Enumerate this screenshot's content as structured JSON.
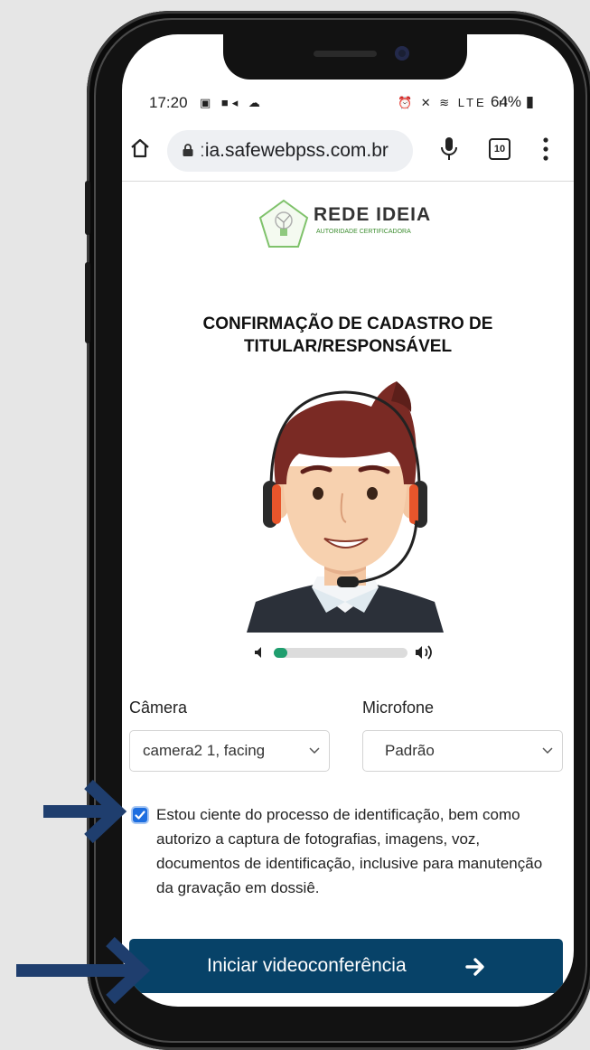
{
  "status_bar": {
    "time": "17:20",
    "left_icons": "▣ ■◂ ☁",
    "right_icons": "⏰ ✕ ≋ LTE .ıl",
    "battery": "64%"
  },
  "browser": {
    "url": "ːia.safewebpss.com.br",
    "tab_count": "10"
  },
  "logo": {
    "title": "REDE IDEIA",
    "subtitle": "AUTORIDADE CERTIFICADORA"
  },
  "page": {
    "title_line1": "CONFIRMAÇÃO DE CADASTRO DE",
    "title_line2": "TITULAR/RESPONSÁVEL"
  },
  "audio_meter": {
    "level": 0.1
  },
  "camera": {
    "label": "Câmera",
    "selected": "camera2 1, facing"
  },
  "microphone": {
    "label": "Microfone",
    "selected": "Padrão"
  },
  "consent": {
    "checked": true,
    "text": "Estou ciente do processo de identificação, bem como autorizo a captura de fotografias, imagens, voz, documentos de identificação, inclusive para manutenção da gravação em dossiê."
  },
  "start_button": {
    "label": "Iniciar videoconferência"
  },
  "colors": {
    "button": "#074268",
    "meter_fill": "#1f9e6e",
    "checkbox": "#1d6ee0",
    "pointer_arrow": "#1f3e6e",
    "headset_accent": "#e8552b"
  },
  "icons": [
    "home-icon",
    "lock-icon",
    "mic-icon",
    "tabs-icon",
    "menu-icon",
    "volume-low-icon",
    "volume-high-icon",
    "chevron-down-icon",
    "arrow-right-icon"
  ]
}
